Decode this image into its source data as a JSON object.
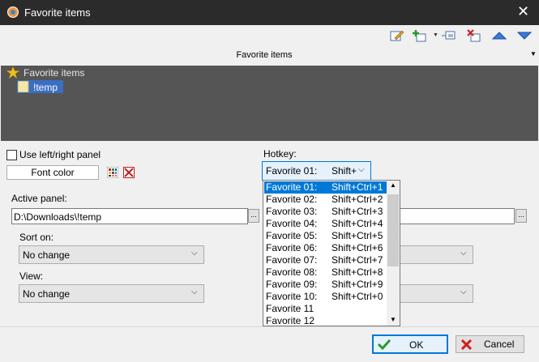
{
  "window": {
    "title": "Favorite items",
    "close_glyph": "✕"
  },
  "toolbar": {
    "icons": [
      "edit-icon",
      "add-item-icon",
      "add-dropdown-arrow-icon",
      "add-submenu-icon",
      "delete-icon",
      "move-up-icon",
      "move-down-icon"
    ],
    "header_label": "Favorite items"
  },
  "tree": {
    "root_label": "Favorite items",
    "child_label": "!temp"
  },
  "options": {
    "use_panel_label": "Use left/right panel",
    "font_color_label": "Font color",
    "hotkey_label": "Hotkey:",
    "hotkey_value_name": "Favorite 01:",
    "hotkey_value_key": "Shift+"
  },
  "active_panel": {
    "label": "Active panel:",
    "path": "D:\\Downloads\\!temp",
    "browse_label": "...",
    "sort_label": "Sort on:",
    "sort_value": "No change",
    "view_label": "View:",
    "view_value": "No change"
  },
  "hotkey_list": [
    {
      "name": "Favorite 01:",
      "key": "Shift+Ctrl+1"
    },
    {
      "name": "Favorite 02:",
      "key": "Shift+Ctrl+2"
    },
    {
      "name": "Favorite 03:",
      "key": "Shift+Ctrl+3"
    },
    {
      "name": "Favorite 04:",
      "key": "Shift+Ctrl+4"
    },
    {
      "name": "Favorite 05:",
      "key": "Shift+Ctrl+5"
    },
    {
      "name": "Favorite 06:",
      "key": "Shift+Ctrl+6"
    },
    {
      "name": "Favorite 07:",
      "key": "Shift+Ctrl+7"
    },
    {
      "name": "Favorite 08:",
      "key": "Shift+Ctrl+8"
    },
    {
      "name": "Favorite 09:",
      "key": "Shift+Ctrl+9"
    },
    {
      "name": "Favorite 10:",
      "key": "Shift+Ctrl+0"
    },
    {
      "name": "Favorite 11",
      "key": ""
    },
    {
      "name": "Favorite 12",
      "key": ""
    }
  ],
  "buttons": {
    "ok_label": "OK",
    "cancel_label": "Cancel"
  },
  "colors": {
    "accent": "#0078d7",
    "titlebar": "#2b2b2b",
    "tree_bg": "#555555"
  }
}
